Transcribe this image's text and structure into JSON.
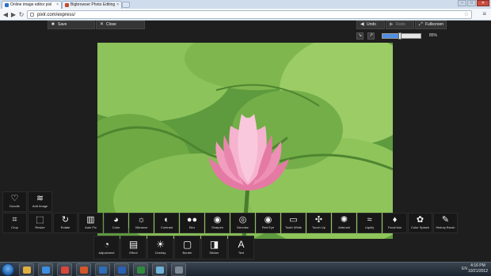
{
  "browser": {
    "tabs": [
      {
        "title": "Online image editor pixl",
        "active": true
      },
      {
        "title": "Bigbrowser Photo Editing",
        "active": false
      }
    ],
    "url": "pixlr.com/express/",
    "window_buttons": [
      "–",
      "□",
      "✕"
    ]
  },
  "editor": {
    "top_left_buttons": [
      {
        "label": "Save",
        "icon": "save-icon"
      },
      {
        "label": "Close",
        "icon": "close-icon"
      }
    ],
    "top_right_buttons": [
      {
        "label": "Undo",
        "icon": "undo-icon"
      },
      {
        "label": "Redo",
        "icon": "redo-icon",
        "disabled": true
      },
      {
        "label": "Fullscreen",
        "icon": "fullscreen-icon"
      }
    ],
    "zoom": {
      "value_label": "85%",
      "level": 0.45
    },
    "tools_upper": [
      {
        "label": "Doodle",
        "icon": "doodle-icon"
      },
      {
        "label": "Add Image",
        "icon": "add-image-icon"
      }
    ],
    "tools_row": [
      {
        "label": "Crop",
        "icon": "crop-icon"
      },
      {
        "label": "Resize",
        "icon": "resize-icon"
      },
      {
        "label": "Rotate",
        "icon": "rotate-icon"
      },
      {
        "label": "Auto Fix",
        "icon": "auto-fix-icon"
      },
      {
        "label": "Color",
        "icon": "palette-icon"
      },
      {
        "label": "Vibrance",
        "icon": "sun-icon"
      },
      {
        "label": "Contrast",
        "icon": "contrast-icon"
      },
      {
        "label": "Blur",
        "icon": "blur-icon"
      },
      {
        "label": "Sharpen",
        "icon": "sharpen-icon"
      },
      {
        "label": "Denoise",
        "icon": "denoise-icon"
      },
      {
        "label": "Red Eye",
        "icon": "eye-icon"
      },
      {
        "label": "Tooth White",
        "icon": "tooth-icon"
      },
      {
        "label": "Touch Up",
        "icon": "touch-up-icon"
      },
      {
        "label": "Airbrush",
        "icon": "airbrush-icon"
      },
      {
        "label": "Liquify",
        "icon": "liquify-icon"
      },
      {
        "label": "Focal blur",
        "icon": "drop-icon"
      },
      {
        "label": "Color Splash",
        "icon": "color-splash-icon"
      },
      {
        "label": "History Brush",
        "icon": "brush-icon"
      }
    ],
    "tools_bottom": [
      {
        "label": "Adjustment",
        "icon": "adjustment-icon"
      },
      {
        "label": "Effect",
        "icon": "effect-icon"
      },
      {
        "label": "Overlay",
        "icon": "lightbulb-icon"
      },
      {
        "label": "Border",
        "icon": "border-icon"
      },
      {
        "label": "Sticker",
        "icon": "sticker-icon"
      },
      {
        "label": "Text",
        "icon": "text-icon"
      }
    ]
  },
  "taskbar": {
    "apps": [
      {
        "icon": "explorer-icon",
        "color": "#e0b040"
      },
      {
        "icon": "ie-icon",
        "color": "#3d8de0"
      },
      {
        "icon": "chrome-icon",
        "color": "#d9473b"
      },
      {
        "icon": "powerpoint-icon",
        "color": "#d4572c"
      },
      {
        "icon": "outlook-icon",
        "color": "#2f6db8"
      },
      {
        "icon": "word-icon",
        "color": "#2b5fb3"
      },
      {
        "icon": "excel-icon",
        "color": "#2f8a3e"
      },
      {
        "icon": "paint-icon",
        "color": "#6fb3d9"
      },
      {
        "icon": "camera-icon",
        "color": "#7e8b97"
      }
    ],
    "lang": "EN",
    "time": "4:16 PM",
    "date": "10/21/2012"
  },
  "colors": {
    "app_bg": "#1e1e1e",
    "accent": "#4d8fe0",
    "toolbar_bg": "#171717"
  }
}
